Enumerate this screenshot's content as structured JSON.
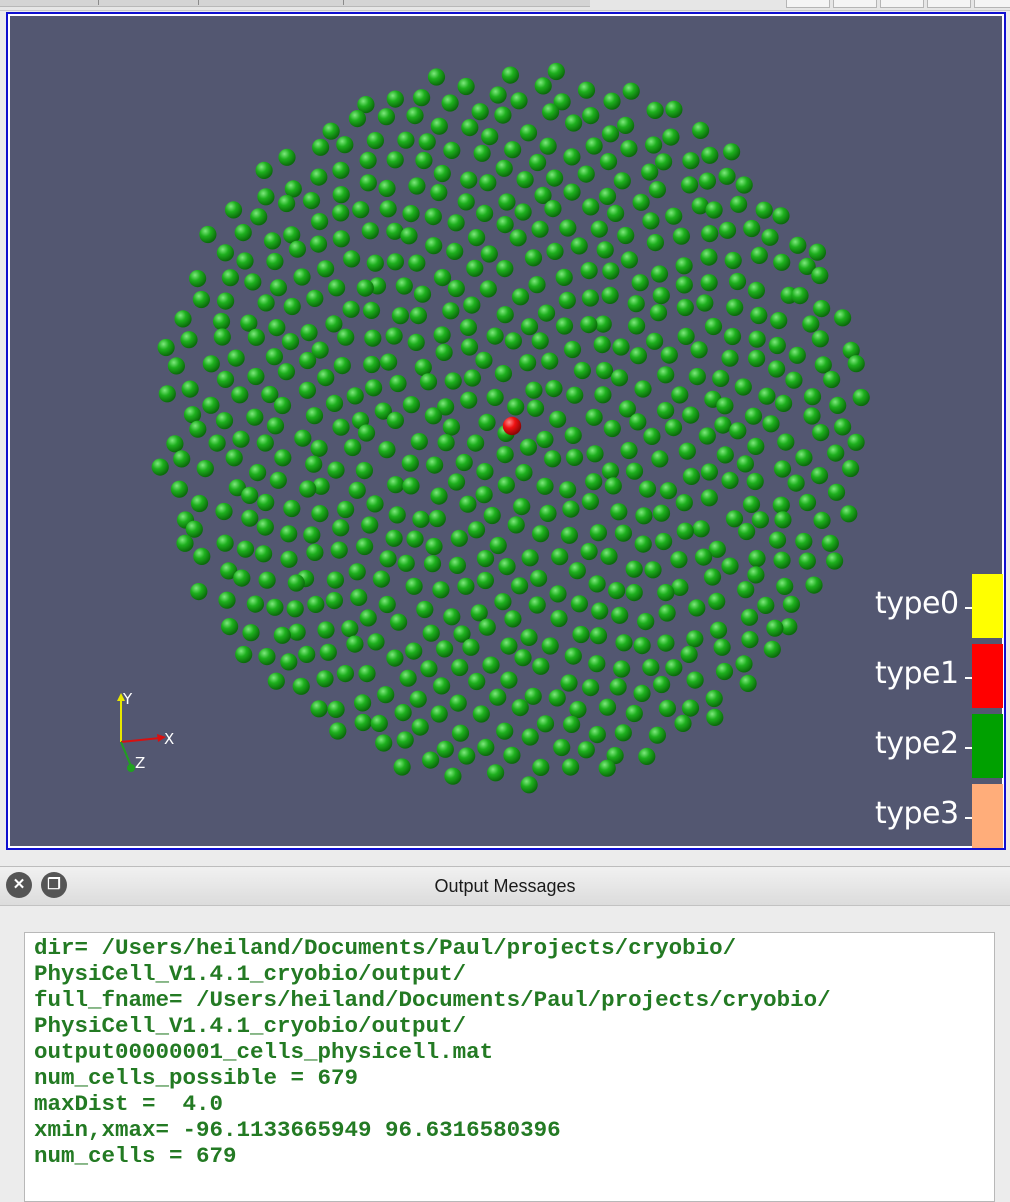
{
  "viewport": {
    "background": "#535771",
    "border_color": "#1010d0",
    "cell_color": "#18a818",
    "highlight_cell_color": "#ee1111"
  },
  "orientation_axes": {
    "x_label": "X",
    "y_label": "Y",
    "z_label": "Z"
  },
  "legend": {
    "items": [
      {
        "label": "type0",
        "color": "#ffff00"
      },
      {
        "label": "type1",
        "color": "#ff0000"
      },
      {
        "label": "type2",
        "color": "#00a000"
      },
      {
        "label": "type3",
        "color": "#ffad7a"
      }
    ]
  },
  "output_panel": {
    "title": "Output Messages",
    "close_icon": "close-icon",
    "restore_icon": "restore-window-icon",
    "lines": [
      "dir= /Users/heiland/Documents/Paul/projects/cryobio/",
      "PhysiCell_V1.4.1_cryobio/output/",
      "full_fname= /Users/heiland/Documents/Paul/projects/cryobio/",
      "PhysiCell_V1.4.1_cryobio/output/",
      "output00000001_cells_physicell.mat",
      "num_cells_possible = 679",
      "maxDist =  4.0",
      "xmin,xmax= -96.1133665949 96.6316580396",
      "num_cells = 679"
    ]
  }
}
